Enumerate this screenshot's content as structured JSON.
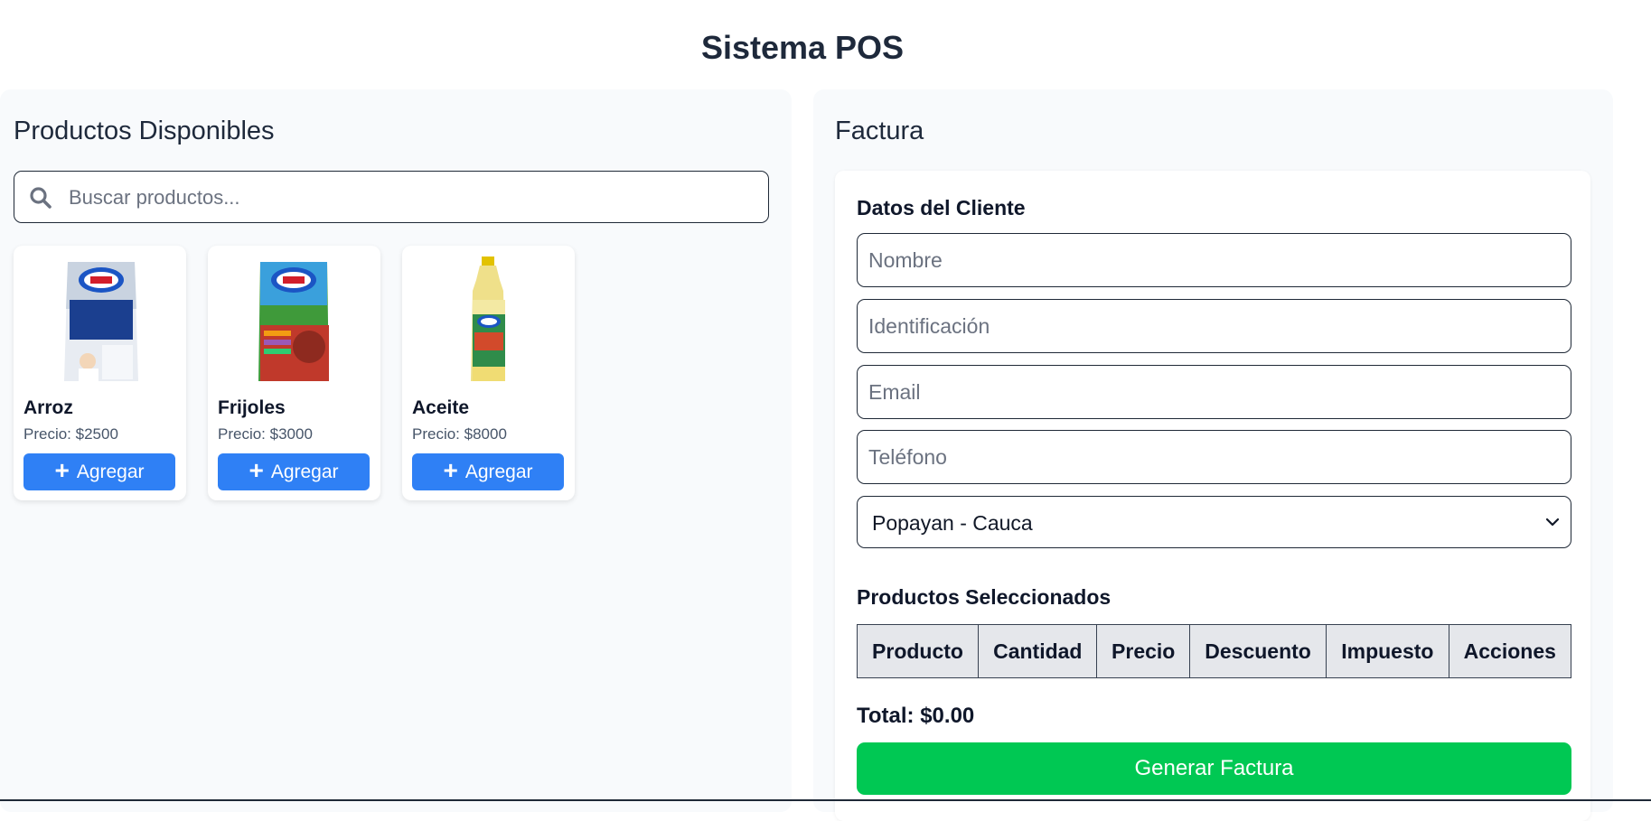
{
  "app": {
    "title": "Sistema POS"
  },
  "products_panel": {
    "heading": "Productos Disponibles",
    "search_placeholder": "Buscar productos...",
    "products": [
      {
        "name": "Arroz",
        "price": "Precio: $2500",
        "button": "Agregar",
        "image": "rice-bag"
      },
      {
        "name": "Frijoles",
        "price": "Precio: $3000",
        "button": "Agregar",
        "image": "beans-bag"
      },
      {
        "name": "Aceite",
        "price": "Precio: $8000",
        "button": "Agregar",
        "image": "oil-bottle"
      }
    ]
  },
  "invoice_panel": {
    "heading": "Factura",
    "client_section": "Datos del Cliente",
    "fields": {
      "name_placeholder": "Nombre",
      "id_placeholder": "Identificación",
      "email_placeholder": "Email",
      "phone_placeholder": "Teléfono",
      "city_selected": "Popayan - Cauca"
    },
    "selected_section": "Productos Seleccionados",
    "table_headers": [
      "Producto",
      "Cantidad",
      "Precio",
      "Descuento",
      "Impuesto",
      "Acciones"
    ],
    "total": "Total: $0.00",
    "generate_button": "Generar Factura"
  },
  "colors": {
    "primary_button": "#2f80f5",
    "success_button": "#00c853",
    "panel_bg": "#f8fafc"
  }
}
